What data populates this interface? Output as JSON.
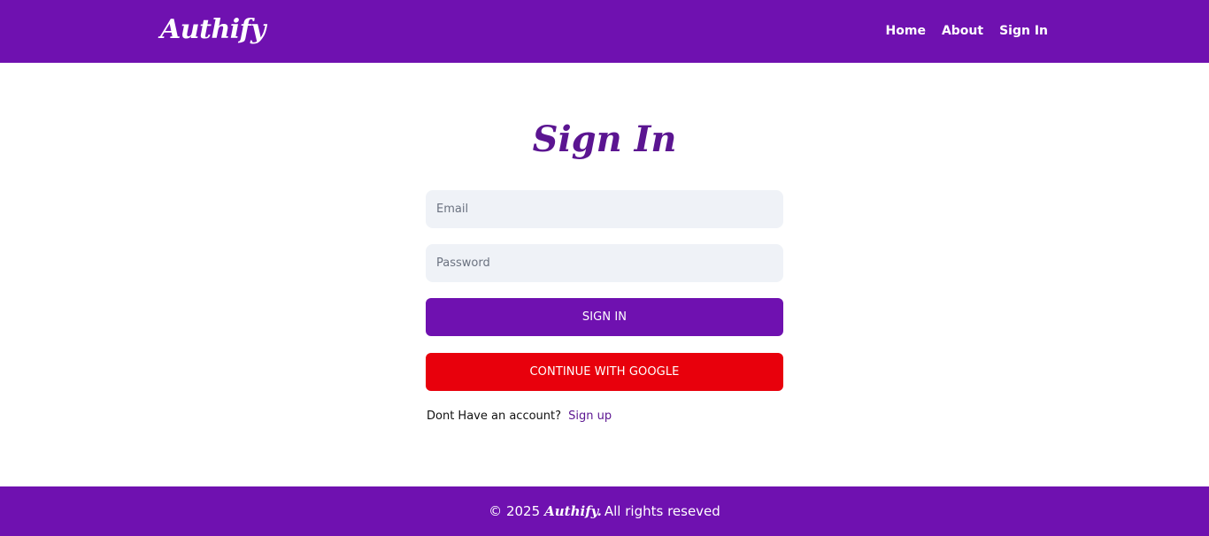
{
  "header": {
    "logo": "Authify",
    "nav": [
      {
        "label": "Home"
      },
      {
        "label": "About"
      },
      {
        "label": "Sign In"
      }
    ]
  },
  "main": {
    "title": "Sign In",
    "email": {
      "placeholder": "Email",
      "value": ""
    },
    "password": {
      "placeholder": "Password",
      "value": ""
    },
    "signin_button": "SIGN IN",
    "google_button": "CONTINUE WITH GOOGLE",
    "signup_prompt": "Dont Have an account?",
    "signup_link": "Sign up"
  },
  "footer": {
    "prefix": "© 2025",
    "brand": "Authify.",
    "suffix": "All rights reseved"
  },
  "colors": {
    "brand_purple": "#6f11b0",
    "title_purple": "#5b1591",
    "google_red": "#e8000c",
    "input_bg": "#eff2f7"
  }
}
